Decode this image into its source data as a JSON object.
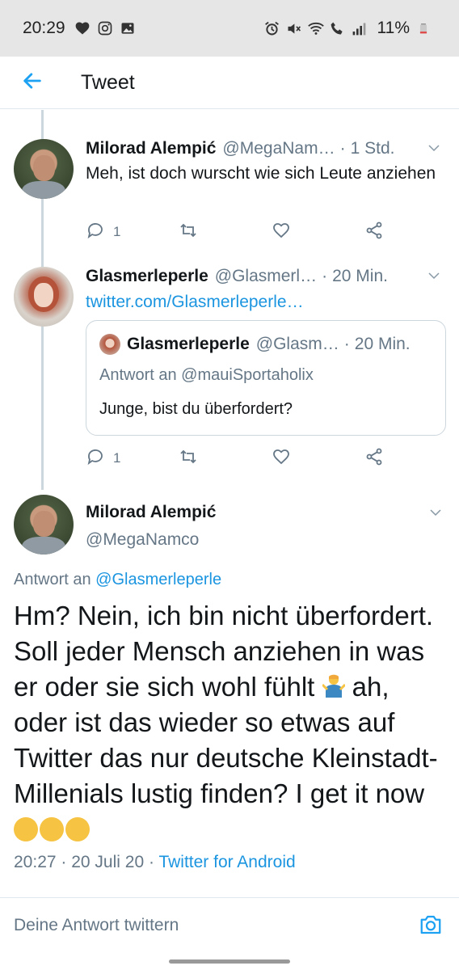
{
  "statusbar": {
    "time": "20:29",
    "battery": "11%"
  },
  "appbar": {
    "title": "Tweet"
  },
  "tweets": [
    {
      "name": "Milorad Alempić",
      "handle": "@MegaNam…",
      "sep": "·",
      "age": "1 Std.",
      "text": "Meh, ist doch wurscht wie sich Leute anziehen",
      "reply_count": "1"
    },
    {
      "name": "Glasmerleperle",
      "handle": "@Glasmerl…",
      "sep": "·",
      "age": "20 Min.",
      "link": "twitter.com/Glasmerleperle…",
      "reply_count": "1",
      "quote": {
        "name": "Glasmerleperle",
        "handle": "@Glasm…",
        "sep": "·",
        "age": "20 Min.",
        "replying": "Antwort an @mauiSportaholix",
        "text": "Junge, bist du überfordert?"
      }
    }
  ],
  "main": {
    "name": "Milorad Alempić",
    "handle": "@MegaNamco",
    "replying_prefix": "Antwort an ",
    "replying_handle": "@Glasmerleperle",
    "text_part1": "Hm? Nein, ich bin nicht überfordert. Soll jeder Mensch anziehen in was er oder sie sich wohl fühlt ",
    "text_part2": " ah, oder ist das wieder so etwas auf Twitter das nur deutsche Kleinstadt-Millenials lustig finden? I get it now ",
    "time": "20:27",
    "sep1": " · ",
    "date": "20 Juli 20",
    "sep2": " · ",
    "source": "Twitter for Android"
  },
  "reply_bar": {
    "placeholder": "Deine Antwort twittern"
  },
  "colors": {
    "link": "#1b95e0",
    "secondary": "#657786",
    "text": "#14171a",
    "statusbar": "#e6e6e6"
  },
  "icons": [
    "heart-icon",
    "instagram-icon",
    "gallery-icon",
    "alarm-icon",
    "mute-icon",
    "wifi-icon",
    "call-icon",
    "signal-icon",
    "battery-icon",
    "back-arrow-icon",
    "chevron-down-icon",
    "reply-icon",
    "retweet-icon",
    "like-icon",
    "share-icon",
    "camera-icon",
    "emoji-shrug-icon",
    "emoji-rofl-icon"
  ]
}
